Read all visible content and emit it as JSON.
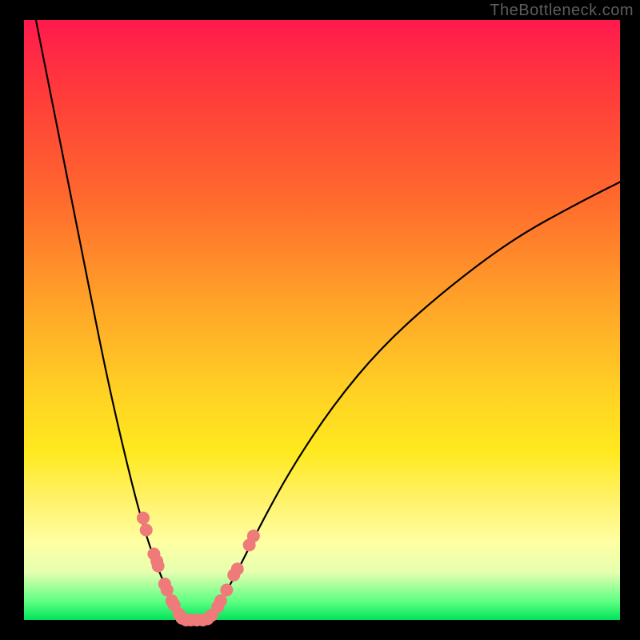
{
  "watermark": "TheBottleneck.com",
  "chart_data": {
    "type": "line",
    "title": "",
    "xlabel": "",
    "ylabel": "",
    "xlim": [
      0,
      1
    ],
    "ylim": [
      0,
      1
    ],
    "background_gradient": {
      "stops": [
        {
          "pos": 0.0,
          "color": "#ff1a4d"
        },
        {
          "pos": 0.12,
          "color": "#ff3b3b"
        },
        {
          "pos": 0.3,
          "color": "#ff6a2d"
        },
        {
          "pos": 0.48,
          "color": "#ffa628"
        },
        {
          "pos": 0.62,
          "color": "#ffd124"
        },
        {
          "pos": 0.72,
          "color": "#ffe91f"
        },
        {
          "pos": 0.8,
          "color": "#fff26a"
        },
        {
          "pos": 0.87,
          "color": "#ffffa3"
        },
        {
          "pos": 0.92,
          "color": "#e6ffb0"
        },
        {
          "pos": 0.97,
          "color": "#5bff82"
        },
        {
          "pos": 1.0,
          "color": "#00e35b"
        }
      ]
    },
    "series": [
      {
        "name": "left-branch",
        "x": [
          0.02,
          0.06,
          0.1,
          0.14,
          0.18,
          0.205,
          0.225,
          0.24,
          0.25,
          0.258,
          0.265
        ],
        "y": [
          1.0,
          0.8,
          0.6,
          0.4,
          0.23,
          0.14,
          0.085,
          0.05,
          0.028,
          0.012,
          0.0
        ]
      },
      {
        "name": "valley-floor",
        "x": [
          0.265,
          0.28,
          0.295,
          0.31
        ],
        "y": [
          0.0,
          0.0,
          0.0,
          0.0
        ]
      },
      {
        "name": "right-branch",
        "x": [
          0.31,
          0.33,
          0.36,
          0.4,
          0.45,
          0.52,
          0.6,
          0.7,
          0.82,
          0.93,
          1.0
        ],
        "y": [
          0.0,
          0.03,
          0.085,
          0.165,
          0.255,
          0.36,
          0.455,
          0.545,
          0.635,
          0.695,
          0.73
        ]
      }
    ],
    "markers": {
      "name": "salmon-dots",
      "color": "#ef7a7a",
      "radius_px": 8,
      "points": [
        {
          "x": 0.2,
          "y": 0.17
        },
        {
          "x": 0.205,
          "y": 0.15
        },
        {
          "x": 0.218,
          "y": 0.11
        },
        {
          "x": 0.223,
          "y": 0.098
        },
        {
          "x": 0.225,
          "y": 0.09
        },
        {
          "x": 0.236,
          "y": 0.06
        },
        {
          "x": 0.24,
          "y": 0.05
        },
        {
          "x": 0.248,
          "y": 0.032
        },
        {
          "x": 0.252,
          "y": 0.025
        },
        {
          "x": 0.26,
          "y": 0.01
        },
        {
          "x": 0.265,
          "y": 0.003
        },
        {
          "x": 0.272,
          "y": 0.0
        },
        {
          "x": 0.28,
          "y": 0.0
        },
        {
          "x": 0.29,
          "y": 0.0
        },
        {
          "x": 0.3,
          "y": 0.0
        },
        {
          "x": 0.308,
          "y": 0.002
        },
        {
          "x": 0.315,
          "y": 0.008
        },
        {
          "x": 0.325,
          "y": 0.022
        },
        {
          "x": 0.33,
          "y": 0.032
        },
        {
          "x": 0.34,
          "y": 0.05
        },
        {
          "x": 0.352,
          "y": 0.075
        },
        {
          "x": 0.358,
          "y": 0.085
        },
        {
          "x": 0.378,
          "y": 0.125
        },
        {
          "x": 0.385,
          "y": 0.14
        }
      ]
    }
  }
}
